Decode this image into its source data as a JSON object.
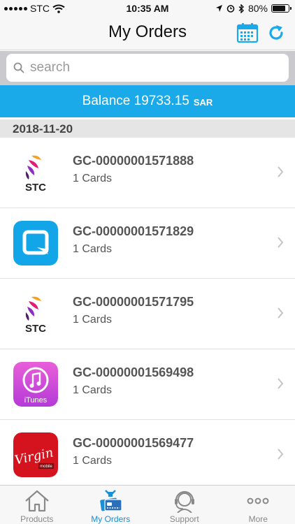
{
  "status_bar": {
    "carrier": "STC",
    "time": "10:35 AM",
    "battery": "80%",
    "battery_level": 0.8
  },
  "header": {
    "title": "My Orders",
    "calendar_icon": "calendar-icon",
    "refresh_icon": "refresh-icon"
  },
  "search": {
    "placeholder": "search",
    "value": ""
  },
  "balance": {
    "label": "Balance 19733.15",
    "currency": "SAR"
  },
  "section": {
    "date": "2018-11-20"
  },
  "orders": [
    {
      "id": "GC-00000001571888",
      "count": "1 Cards",
      "brand": "stc"
    },
    {
      "id": "GC-00000001571829",
      "count": "1 Cards",
      "brand": "mobily"
    },
    {
      "id": "GC-00000001571795",
      "count": "1 Cards",
      "brand": "stc"
    },
    {
      "id": "GC-00000001569498",
      "count": "1 Cards",
      "brand": "itunes"
    },
    {
      "id": "GC-00000001569477",
      "count": "1 Cards",
      "brand": "virgin"
    }
  ],
  "logos": {
    "stc": "STC",
    "itunes": "iTunes",
    "virgin": "Virgin",
    "virgin_sub": "mobile"
  },
  "tabs": [
    {
      "label": "Products",
      "icon": "home-icon"
    },
    {
      "label": "My Orders",
      "icon": "orders-icon",
      "active": true
    },
    {
      "label": "Support",
      "icon": "headset-icon"
    },
    {
      "label": "More",
      "icon": "more-icon"
    }
  ],
  "colors": {
    "accent": "#1aaaea",
    "active_tab": "#1a8fd6",
    "stc_purple": "#4b1f6f",
    "mobily_blue": "#12a6e8",
    "itunes_pink": "#d452dc",
    "virgin_red": "#d4131e"
  }
}
